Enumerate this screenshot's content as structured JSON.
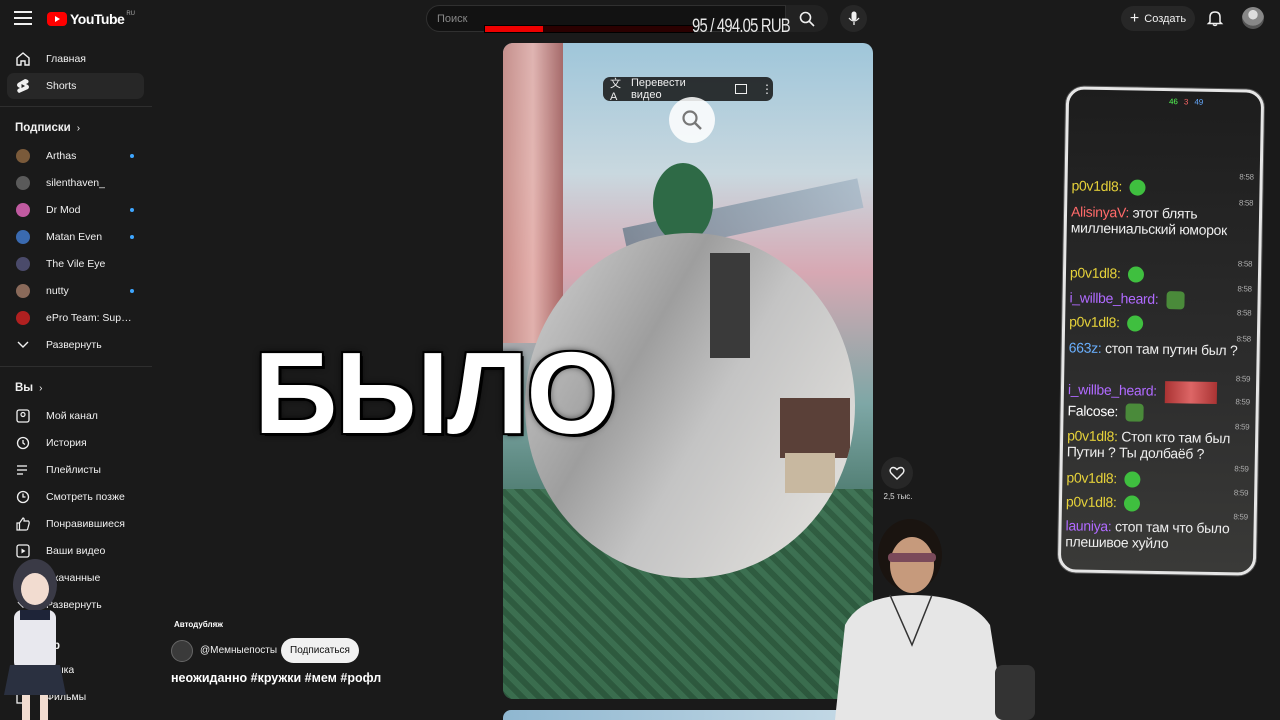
{
  "header": {
    "logo_text": "YouTube",
    "logo_region": "RU",
    "search_placeholder": "Поиск",
    "donation_text": "95 / 494.05 RUB",
    "donation_progress": 0.28,
    "create_label": "Создать"
  },
  "sidebar": {
    "top_items": [
      {
        "label": "Главная",
        "icon": "home-icon"
      },
      {
        "label": "Shorts",
        "icon": "shorts-icon"
      }
    ],
    "subscriptions_title": "Подписки",
    "subscriptions": [
      {
        "label": "Arthas",
        "new": true,
        "color": "#7a5a3a"
      },
      {
        "label": "silenthaven_",
        "new": false,
        "color": "#5a5a5a"
      },
      {
        "label": "Dr Mod",
        "new": true,
        "color": "#c05aa0"
      },
      {
        "label": "Matan Even",
        "new": true,
        "color": "#3a6ab0"
      },
      {
        "label": "The Vile Eye",
        "new": false,
        "color": "#4a4a6a"
      },
      {
        "label": "nutty",
        "new": true,
        "color": "#8a6a5a"
      },
      {
        "label": "ePro Team: Suppor...",
        "new": false,
        "color": "#b02020"
      }
    ],
    "expand_label": "Развернуть",
    "you_title": "Вы",
    "you_items": [
      {
        "label": "Мой канал",
        "icon": "channel-icon"
      },
      {
        "label": "История",
        "icon": "history-icon"
      },
      {
        "label": "Плейлисты",
        "icon": "playlists-icon"
      },
      {
        "label": "Смотреть позже",
        "icon": "watch-later-icon"
      },
      {
        "label": "Понравившиеся",
        "icon": "like-icon"
      },
      {
        "label": "Ваши видео",
        "icon": "your-videos-icon"
      },
      {
        "label": "Скачанные",
        "icon": "download-icon"
      },
      {
        "label": "Развернуть",
        "icon": "chevron-down-icon"
      }
    ],
    "explore_title": "ор",
    "explore_items": [
      {
        "label": "узыка",
        "icon": "music-icon"
      },
      {
        "label": "Фильмы",
        "icon": "movies-icon"
      }
    ]
  },
  "video": {
    "translate_label": "Перевести видео",
    "overlay_text": "БЫЛО",
    "like_count": "2,5 тыс.",
    "autodub_label": "Автодубляж",
    "channel": "@Мемныепосты",
    "subscribe_label": "Подписаться",
    "description": "неожиданно #кружки #мем #рофл"
  },
  "chat": {
    "status": {
      "a": "46",
      "b": "3",
      "c": "49"
    },
    "messages": [
      {
        "nick": "p0v1dl8:",
        "text": "",
        "emote": "round",
        "time": "8:58",
        "color": "#e6d23a"
      },
      {
        "nick": "AlisinyaV:",
        "text": "этот блять миллениальский юморок",
        "emote": "",
        "time": "8:58",
        "color": "#ff6a6a"
      },
      {
        "nick": "p0v1dl8:",
        "text": "",
        "emote": "round",
        "time": "8:58",
        "color": "#e6d23a"
      },
      {
        "nick": "i_willbe_heard:",
        "text": "",
        "emote": "small",
        "time": "8:58",
        "color": "#b06aff"
      },
      {
        "nick": "p0v1dl8:",
        "text": "",
        "emote": "round",
        "time": "8:58",
        "color": "#e6d23a"
      },
      {
        "nick": "663z:",
        "text": "стоп там путин был ?",
        "emote": "",
        "time": "8:58",
        "color": "#6ab0ff"
      },
      {
        "nick": "i_willbe_heard:",
        "text": "",
        "emote": "image",
        "time": "8:59",
        "color": "#b06aff"
      },
      {
        "nick": "Falcose:",
        "text": "",
        "emote": "small",
        "time": "8:59",
        "color": "#ffffff"
      },
      {
        "nick": "p0v1dl8:",
        "text": "Стоп кто там был Путин ? Ты долбаёб ?",
        "emote": "",
        "time": "8:59",
        "color": "#e6d23a"
      },
      {
        "nick": "p0v1dl8:",
        "text": "",
        "emote": "round",
        "time": "8:59",
        "color": "#e6d23a"
      },
      {
        "nick": "p0v1dl8:",
        "text": "",
        "emote": "round",
        "time": "8:59",
        "color": "#e6d23a"
      },
      {
        "nick": "launiya:",
        "text": "стоп там что было плешивое хуйло",
        "emote": "",
        "time": "8:59",
        "color": "#b06aff"
      }
    ]
  },
  "colors": {
    "accent": "#ff0000",
    "link": "#3ea6ff"
  }
}
